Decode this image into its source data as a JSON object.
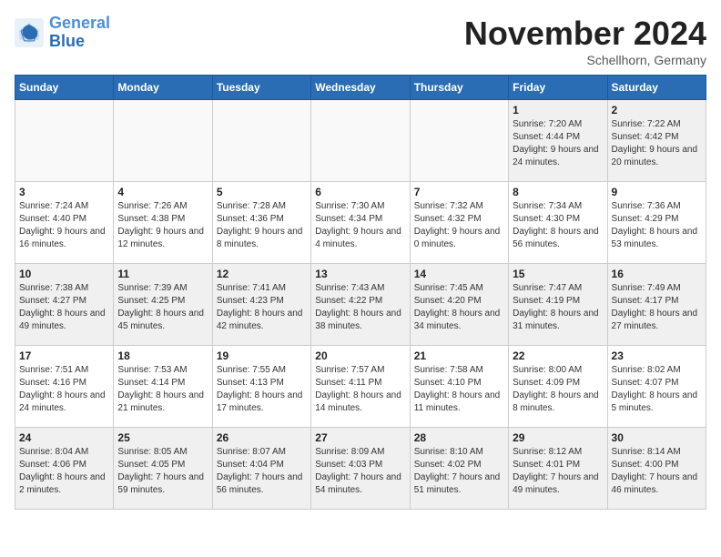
{
  "header": {
    "logo_line1": "General",
    "logo_line2": "Blue",
    "month": "November 2024",
    "location": "Schellhorn, Germany"
  },
  "weekdays": [
    "Sunday",
    "Monday",
    "Tuesday",
    "Wednesday",
    "Thursday",
    "Friday",
    "Saturday"
  ],
  "weeks": [
    [
      {
        "day": "",
        "info": "",
        "empty": true
      },
      {
        "day": "",
        "info": "",
        "empty": true
      },
      {
        "day": "",
        "info": "",
        "empty": true
      },
      {
        "day": "",
        "info": "",
        "empty": true
      },
      {
        "day": "",
        "info": "",
        "empty": true
      },
      {
        "day": "1",
        "info": "Sunrise: 7:20 AM\nSunset: 4:44 PM\nDaylight: 9 hours\nand 24 minutes.",
        "empty": false
      },
      {
        "day": "2",
        "info": "Sunrise: 7:22 AM\nSunset: 4:42 PM\nDaylight: 9 hours\nand 20 minutes.",
        "empty": false
      }
    ],
    [
      {
        "day": "3",
        "info": "Sunrise: 7:24 AM\nSunset: 4:40 PM\nDaylight: 9 hours\nand 16 minutes.",
        "empty": false
      },
      {
        "day": "4",
        "info": "Sunrise: 7:26 AM\nSunset: 4:38 PM\nDaylight: 9 hours\nand 12 minutes.",
        "empty": false
      },
      {
        "day": "5",
        "info": "Sunrise: 7:28 AM\nSunset: 4:36 PM\nDaylight: 9 hours\nand 8 minutes.",
        "empty": false
      },
      {
        "day": "6",
        "info": "Sunrise: 7:30 AM\nSunset: 4:34 PM\nDaylight: 9 hours\nand 4 minutes.",
        "empty": false
      },
      {
        "day": "7",
        "info": "Sunrise: 7:32 AM\nSunset: 4:32 PM\nDaylight: 9 hours\nand 0 minutes.",
        "empty": false
      },
      {
        "day": "8",
        "info": "Sunrise: 7:34 AM\nSunset: 4:30 PM\nDaylight: 8 hours\nand 56 minutes.",
        "empty": false
      },
      {
        "day": "9",
        "info": "Sunrise: 7:36 AM\nSunset: 4:29 PM\nDaylight: 8 hours\nand 53 minutes.",
        "empty": false
      }
    ],
    [
      {
        "day": "10",
        "info": "Sunrise: 7:38 AM\nSunset: 4:27 PM\nDaylight: 8 hours\nand 49 minutes.",
        "empty": false
      },
      {
        "day": "11",
        "info": "Sunrise: 7:39 AM\nSunset: 4:25 PM\nDaylight: 8 hours\nand 45 minutes.",
        "empty": false
      },
      {
        "day": "12",
        "info": "Sunrise: 7:41 AM\nSunset: 4:23 PM\nDaylight: 8 hours\nand 42 minutes.",
        "empty": false
      },
      {
        "day": "13",
        "info": "Sunrise: 7:43 AM\nSunset: 4:22 PM\nDaylight: 8 hours\nand 38 minutes.",
        "empty": false
      },
      {
        "day": "14",
        "info": "Sunrise: 7:45 AM\nSunset: 4:20 PM\nDaylight: 8 hours\nand 34 minutes.",
        "empty": false
      },
      {
        "day": "15",
        "info": "Sunrise: 7:47 AM\nSunset: 4:19 PM\nDaylight: 8 hours\nand 31 minutes.",
        "empty": false
      },
      {
        "day": "16",
        "info": "Sunrise: 7:49 AM\nSunset: 4:17 PM\nDaylight: 8 hours\nand 27 minutes.",
        "empty": false
      }
    ],
    [
      {
        "day": "17",
        "info": "Sunrise: 7:51 AM\nSunset: 4:16 PM\nDaylight: 8 hours\nand 24 minutes.",
        "empty": false
      },
      {
        "day": "18",
        "info": "Sunrise: 7:53 AM\nSunset: 4:14 PM\nDaylight: 8 hours\nand 21 minutes.",
        "empty": false
      },
      {
        "day": "19",
        "info": "Sunrise: 7:55 AM\nSunset: 4:13 PM\nDaylight: 8 hours\nand 17 minutes.",
        "empty": false
      },
      {
        "day": "20",
        "info": "Sunrise: 7:57 AM\nSunset: 4:11 PM\nDaylight: 8 hours\nand 14 minutes.",
        "empty": false
      },
      {
        "day": "21",
        "info": "Sunrise: 7:58 AM\nSunset: 4:10 PM\nDaylight: 8 hours\nand 11 minutes.",
        "empty": false
      },
      {
        "day": "22",
        "info": "Sunrise: 8:00 AM\nSunset: 4:09 PM\nDaylight: 8 hours\nand 8 minutes.",
        "empty": false
      },
      {
        "day": "23",
        "info": "Sunrise: 8:02 AM\nSunset: 4:07 PM\nDaylight: 8 hours\nand 5 minutes.",
        "empty": false
      }
    ],
    [
      {
        "day": "24",
        "info": "Sunrise: 8:04 AM\nSunset: 4:06 PM\nDaylight: 8 hours\nand 2 minutes.",
        "empty": false
      },
      {
        "day": "25",
        "info": "Sunrise: 8:05 AM\nSunset: 4:05 PM\nDaylight: 7 hours\nand 59 minutes.",
        "empty": false
      },
      {
        "day": "26",
        "info": "Sunrise: 8:07 AM\nSunset: 4:04 PM\nDaylight: 7 hours\nand 56 minutes.",
        "empty": false
      },
      {
        "day": "27",
        "info": "Sunrise: 8:09 AM\nSunset: 4:03 PM\nDaylight: 7 hours\nand 54 minutes.",
        "empty": false
      },
      {
        "day": "28",
        "info": "Sunrise: 8:10 AM\nSunset: 4:02 PM\nDaylight: 7 hours\nand 51 minutes.",
        "empty": false
      },
      {
        "day": "29",
        "info": "Sunrise: 8:12 AM\nSunset: 4:01 PM\nDaylight: 7 hours\nand 49 minutes.",
        "empty": false
      },
      {
        "day": "30",
        "info": "Sunrise: 8:14 AM\nSunset: 4:00 PM\nDaylight: 7 hours\nand 46 minutes.",
        "empty": false
      }
    ]
  ]
}
